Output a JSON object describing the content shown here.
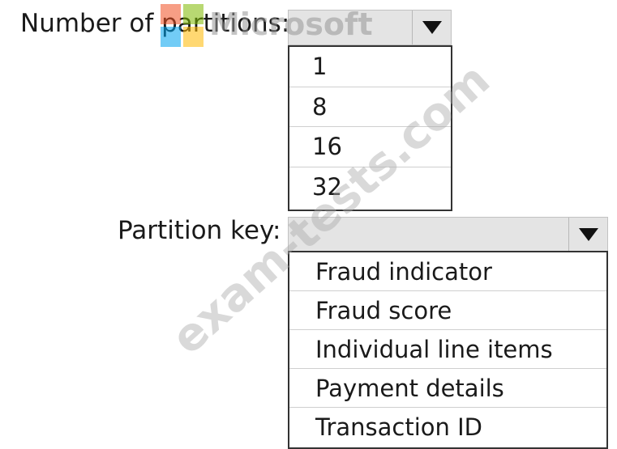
{
  "partitions": {
    "label": "Number of partitions:",
    "selected_value": "",
    "options": [
      "1",
      "8",
      "16",
      "32"
    ]
  },
  "partition_key": {
    "label": "Partition key:",
    "selected_value": "",
    "options": [
      "Fraud indicator",
      "Fraud score",
      "Individual line items",
      "Payment details",
      "Transaction ID"
    ]
  },
  "logo": {
    "text": "Microsoft",
    "colors": [
      "#f25022",
      "#7fba00",
      "#00a4ef",
      "#ffb900"
    ]
  },
  "watermark": {
    "text": "exam-tests.com"
  },
  "icons": {
    "dropdown_arrow": "chevron-down-icon",
    "logo": "microsoft-logo-icon"
  }
}
